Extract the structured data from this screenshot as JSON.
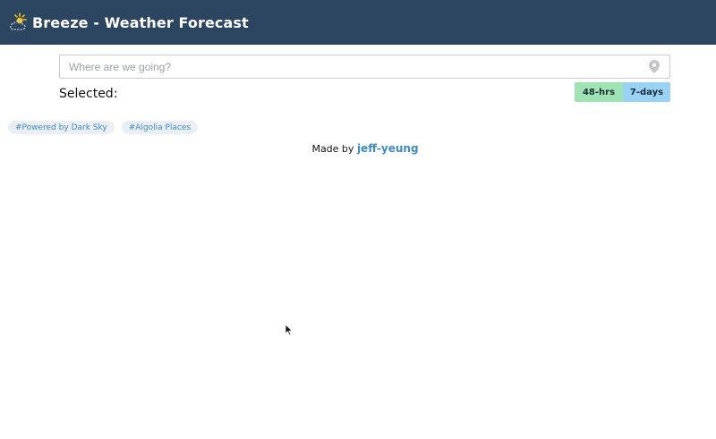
{
  "header": {
    "logo_icon": "sun-cloud-icon",
    "title": "Breeze - Weather Forecast",
    "background": "#2c4662"
  },
  "search": {
    "placeholder": "Where are we going?",
    "value": "",
    "icon": "map-pin-icon"
  },
  "selection": {
    "label": "Selected:"
  },
  "range_toggle": {
    "options": [
      {
        "label": "48-hrs",
        "color": "#9ee3b2"
      },
      {
        "label": "7-days",
        "color": "#98d3f5"
      }
    ]
  },
  "tags": [
    {
      "label": "#Powered by Dark Sky"
    },
    {
      "label": "#Algolia Places"
    }
  ],
  "footer": {
    "made_by_prefix": "Made by",
    "author": "jeff-yeung",
    "link_color": "#3a8dcc"
  }
}
